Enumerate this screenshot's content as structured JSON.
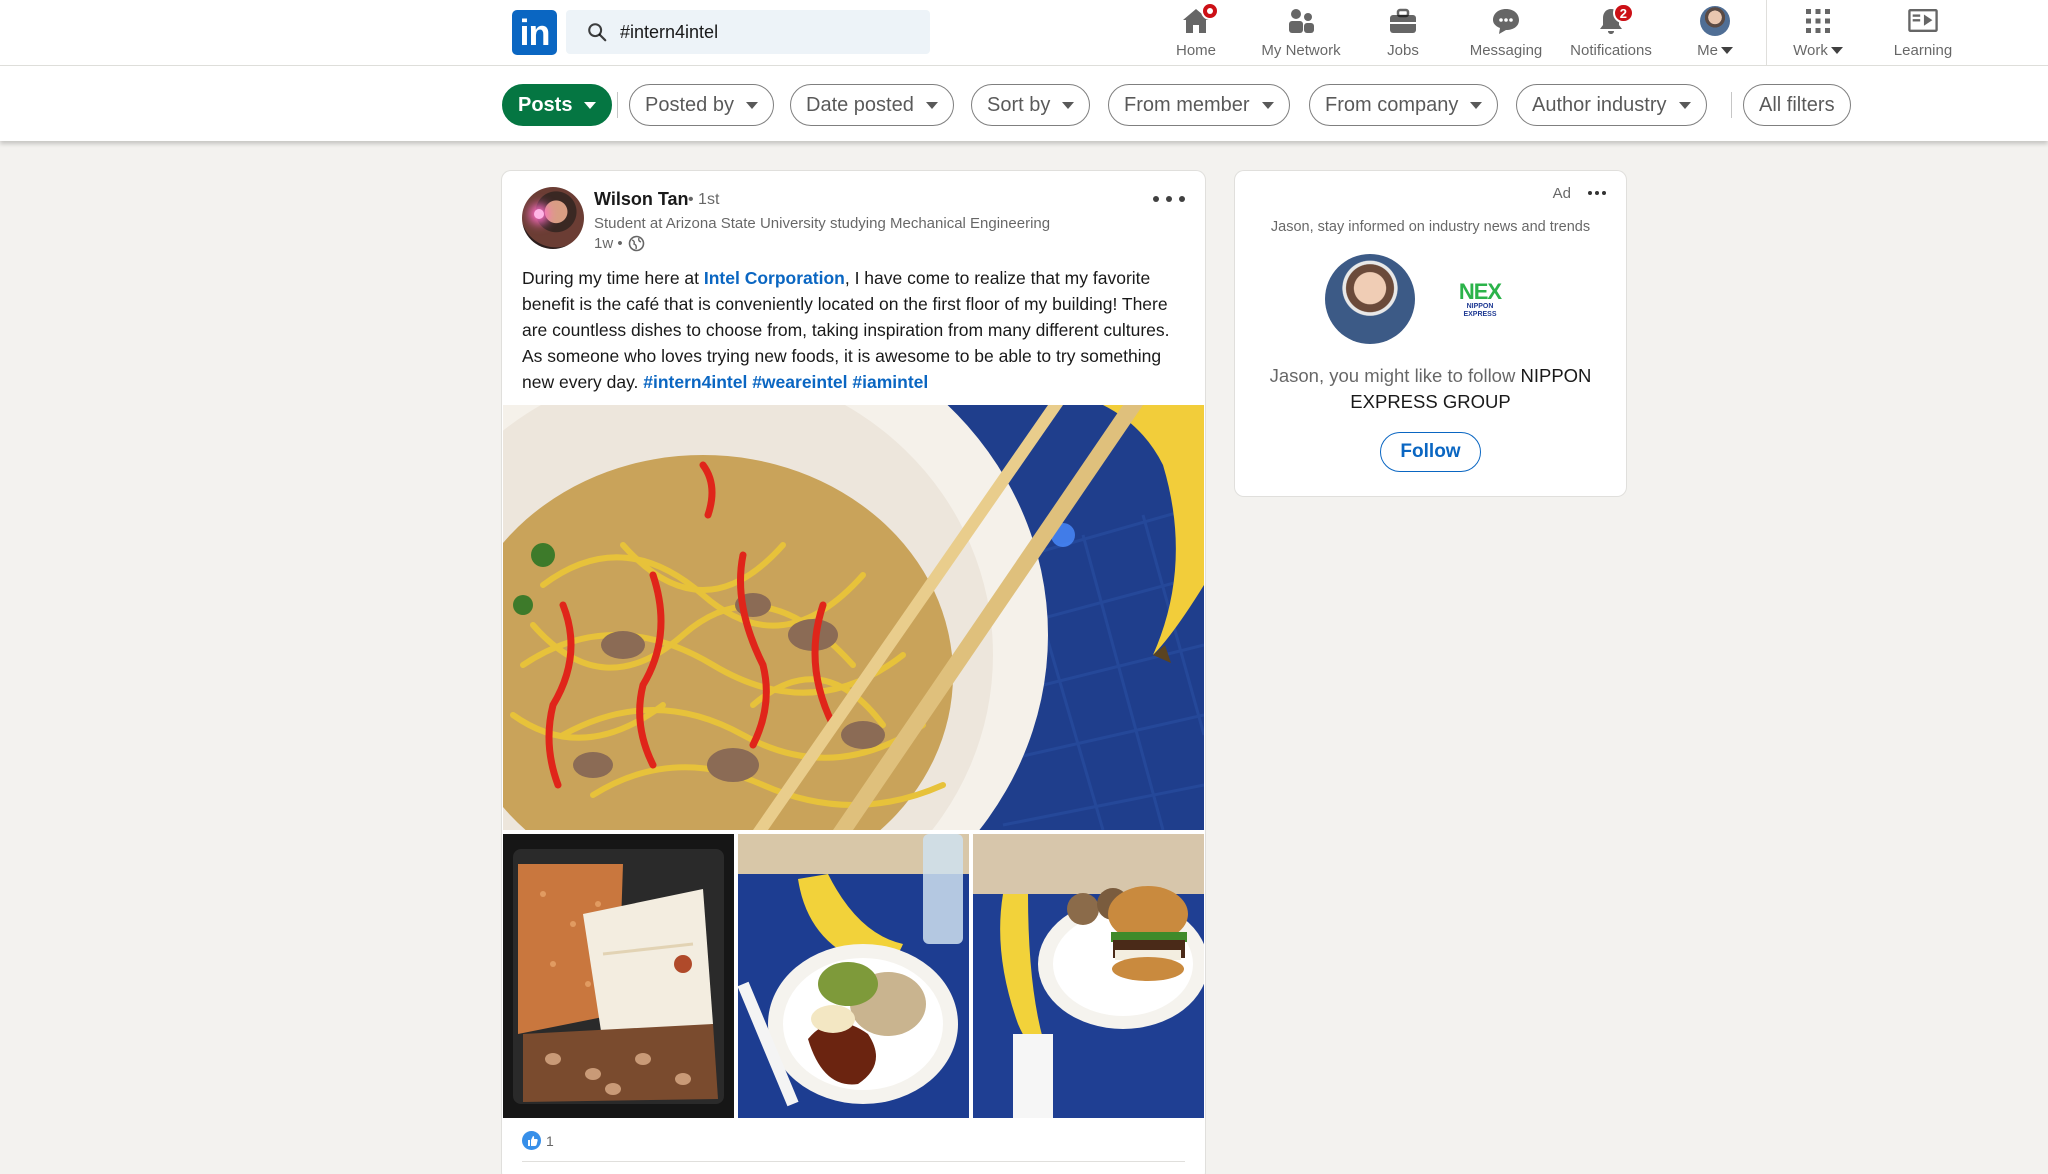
{
  "search": {
    "value": "#intern4intel"
  },
  "nav": {
    "home": "Home",
    "network": "My Network",
    "jobs": "Jobs",
    "messaging": "Messaging",
    "notifications": "Notifications",
    "notifications_count": "2",
    "me": "Me",
    "work": "Work",
    "learning": "Learning"
  },
  "filters": {
    "posts": "Posts",
    "posted_by": "Posted by",
    "date_posted": "Date posted",
    "sort_by": "Sort by",
    "from_member": "From member",
    "from_company": "From company",
    "author_industry": "Author industry",
    "all_filters": "All filters"
  },
  "post": {
    "author_name": "Wilson Tan",
    "degree": "• 1st",
    "headline": "Student at Arizona State University studying Mechanical Engineering",
    "time": "1w •",
    "text_1": "During my time here at ",
    "company_link": "Intel Corporation",
    "text_2": ", I have come to realize that my favorite benefit is the café that is conveniently located on the first floor of my building! There are countless dishes to choose from, taking inspiration from many different cultures. As someone who loves trying new foods, it is awesome to be able to try something new every day. ",
    "hashtag_1": "#intern4intel",
    "hashtag_2": "#weareintel",
    "hashtag_3": "#iamintel",
    "reaction_count": "1"
  },
  "ad": {
    "label": "Ad",
    "tagline": "Jason, stay informed on industry news and trends",
    "logo_main": "NEX",
    "logo_sub": "NIPPON EXPRESS",
    "text_prefix": "Jason, you might like to follow ",
    "company": "NIPPON EXPRESS GROUP",
    "follow": "Follow"
  },
  "colors": {
    "brand_blue": "#0a66c2",
    "active_pill": "#057642",
    "badge_red": "#cc1016",
    "page_bg": "#f3f2ef"
  }
}
